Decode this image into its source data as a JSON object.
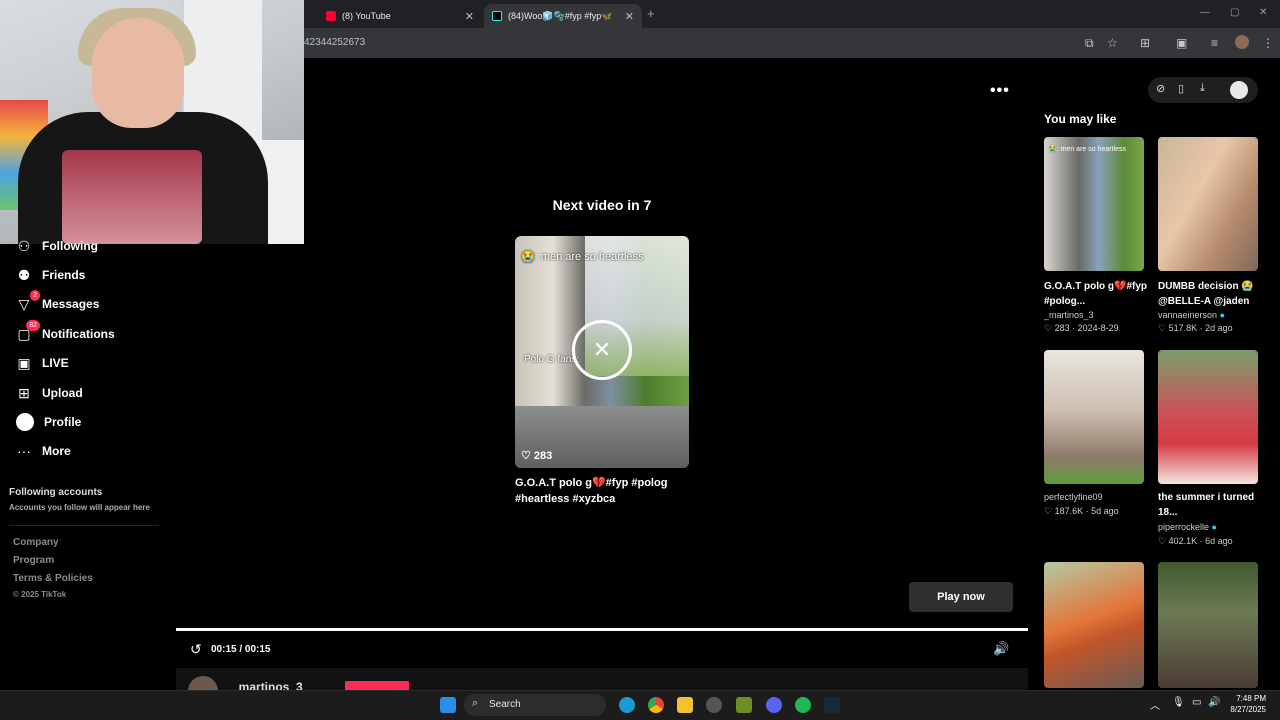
{
  "browser": {
    "tabs": [
      {
        "label": "(8) YouTube",
        "active": false
      },
      {
        "label": "(84)Woo🧊🫧#fyp #fyp🦋",
        "active": true
      }
    ],
    "new_tab": "+",
    "tab_close": "✕",
    "address": "42344252673"
  },
  "sidebar": {
    "items": [
      {
        "label": "Following",
        "icon": "following-icon"
      },
      {
        "label": "Friends",
        "icon": "friends-icon"
      },
      {
        "label": "Messages",
        "icon": "messages-icon",
        "badge": "2"
      },
      {
        "label": "Notifications",
        "icon": "notifications-icon",
        "badge": "82"
      },
      {
        "label": "LIVE",
        "icon": "live-icon"
      },
      {
        "label": "Upload",
        "icon": "upload-icon"
      },
      {
        "label": "Profile",
        "icon": "profile-icon"
      },
      {
        "label": "More",
        "icon": "more-icon"
      }
    ],
    "following_accounts_title": "Following accounts",
    "following_accounts_hint": "Accounts you follow will appear here",
    "footer": [
      "Company",
      "Program",
      "Terms & Policies",
      "© 2025 TikTok"
    ]
  },
  "next_video": {
    "heading": "Next video in 7",
    "caption_overlay": "😭: men are so heartless",
    "caption_overlay_2": "Polo G fans:",
    "likes": "283",
    "title": "G.O.A.T polo g💔#fyp #polog #heartless #xyzbca"
  },
  "player": {
    "time": "00:15 / 00:15",
    "play_now": "Play now",
    "more": "•••",
    "author": "_martinos_3"
  },
  "you_may_like": {
    "heading": "You may like",
    "cards": [
      {
        "title": "G.O.A.T polo g💔#fyp #polog...",
        "author": "_martinos_3",
        "meta": "♡ 283 · 2024-8-29",
        "overlay": "😭: men are so heartless"
      },
      {
        "title": "DUMBB decision 😭 @BELLE-A @jaden",
        "author": "vannaeinerson",
        "verified": true,
        "meta": "♡ 517.8K · 2d ago"
      },
      {
        "title": "",
        "author": "perfectlyfine09",
        "meta": "♡ 187.6K · 5d ago"
      },
      {
        "title": "the summer i turned 18...",
        "author": "piperrockelle",
        "verified": true,
        "meta": "♡ 402.1K · 6d ago"
      }
    ]
  },
  "taskbar": {
    "search": "Search",
    "time": "7:48 PM",
    "date": "8/27/2025"
  }
}
